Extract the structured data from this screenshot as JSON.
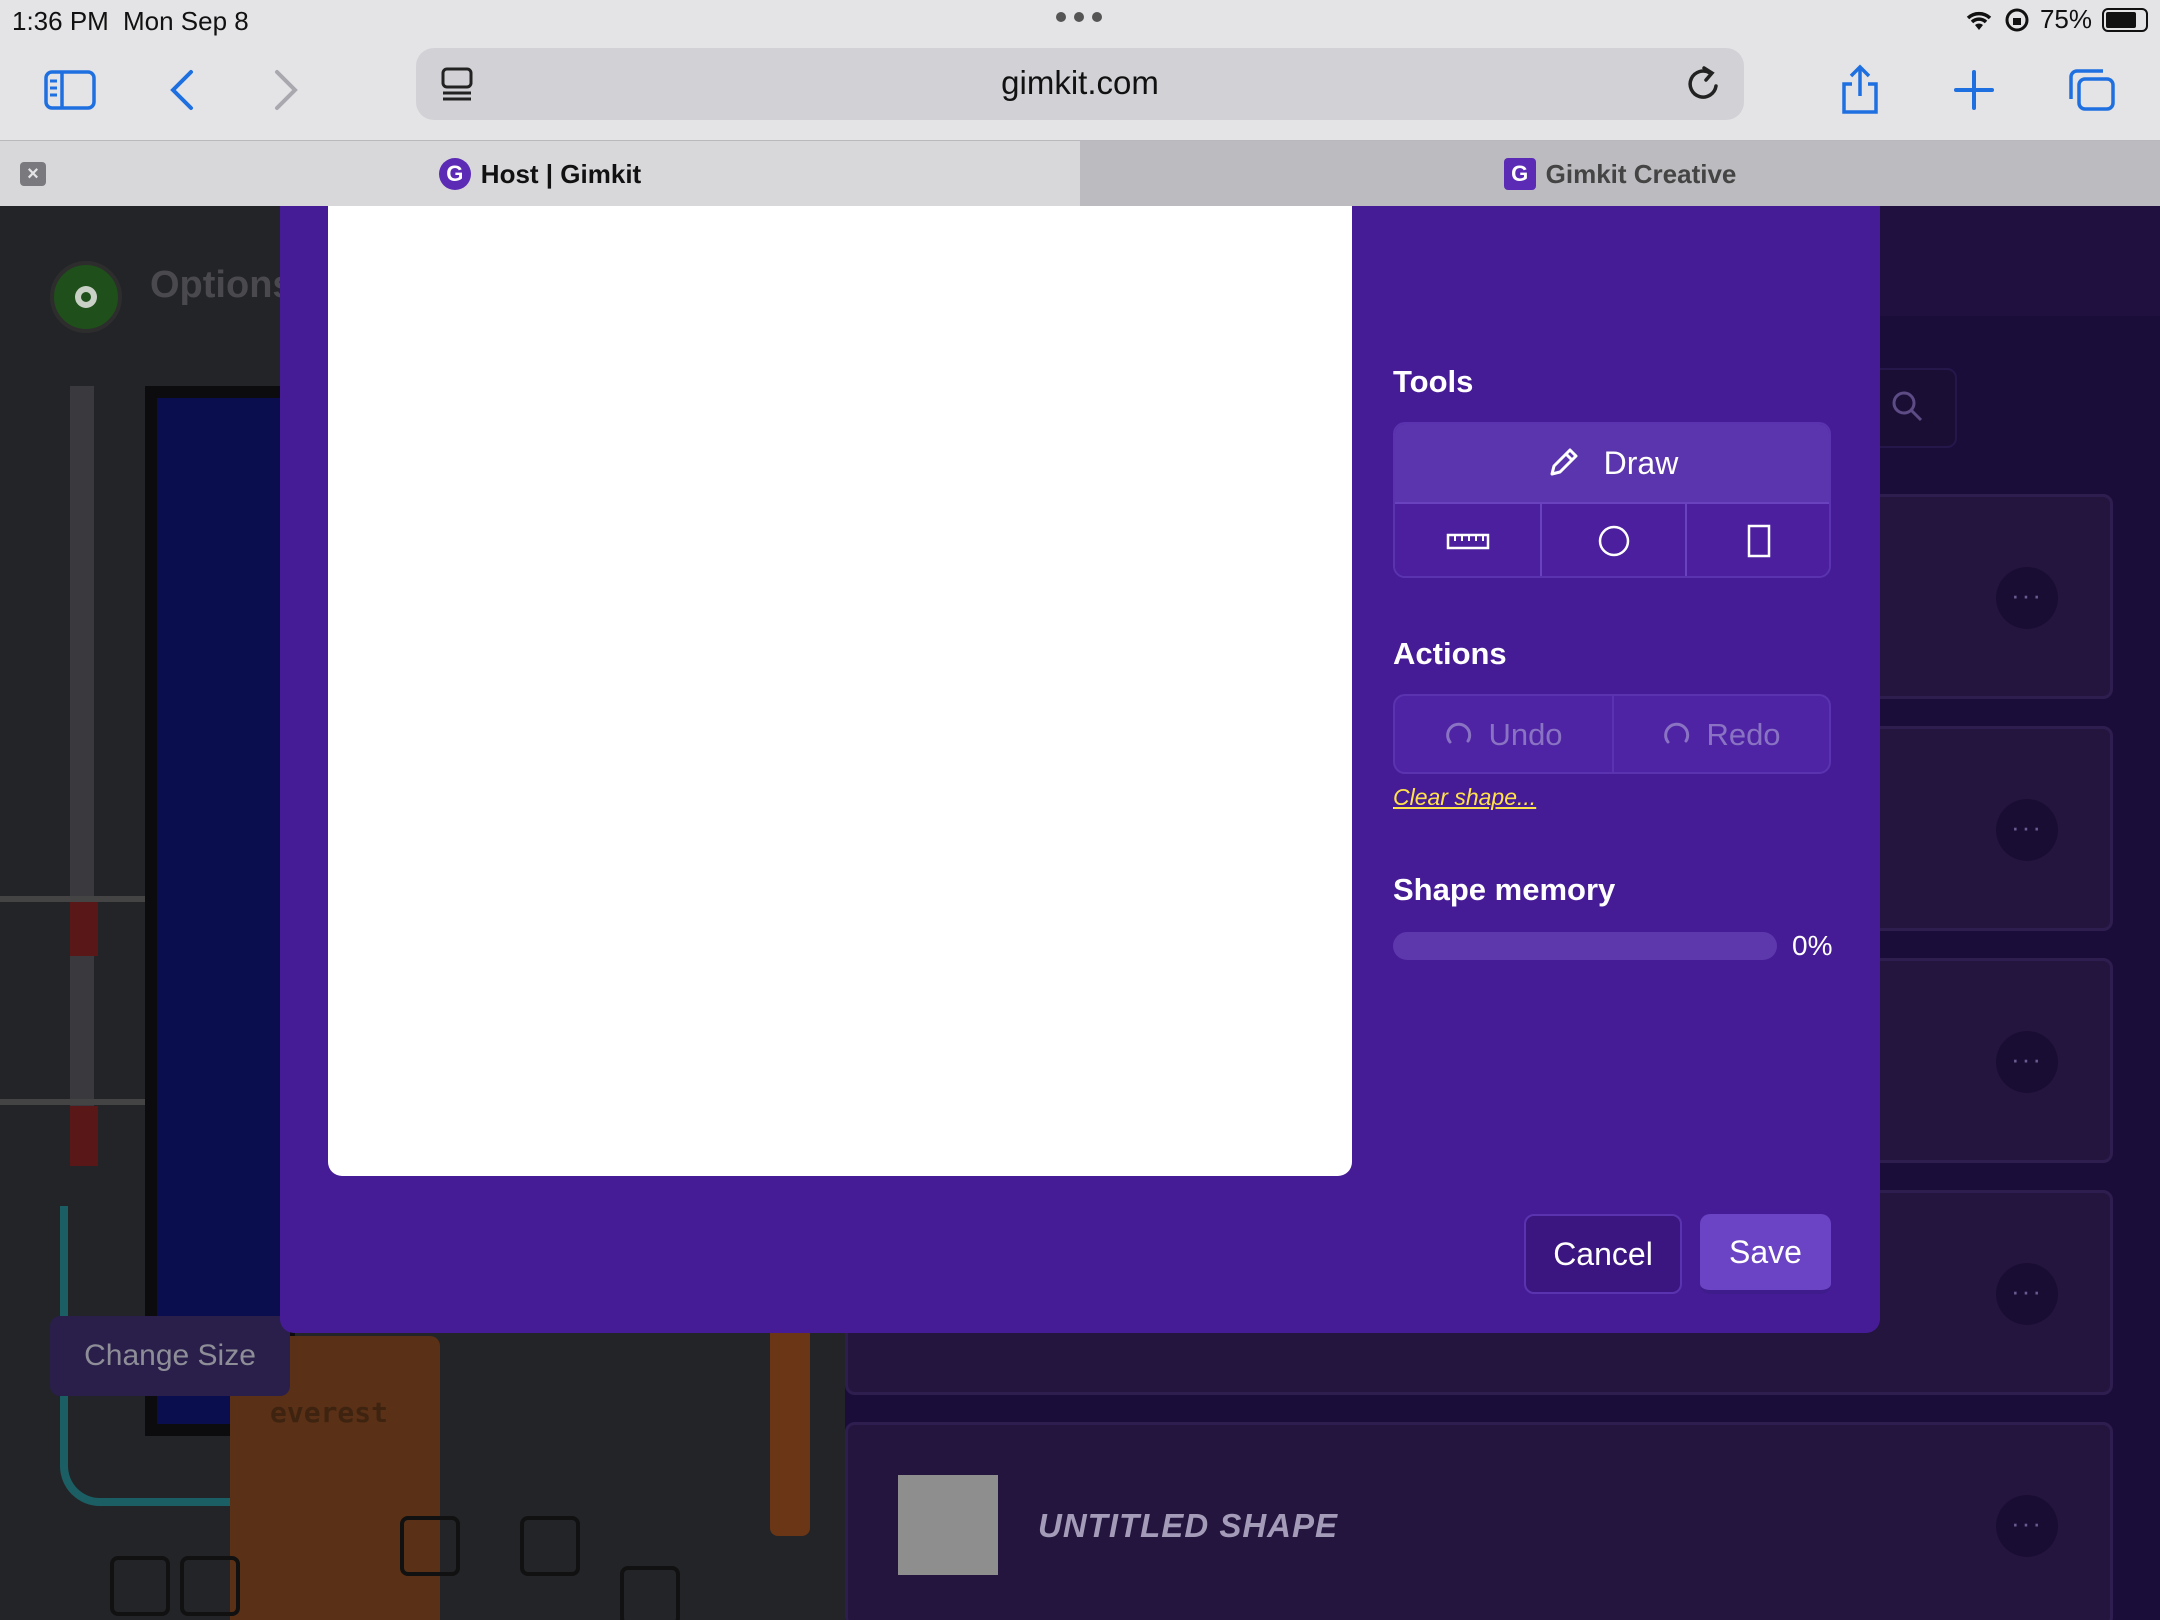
{
  "status_bar": {
    "time": "1:36 PM",
    "date": "Mon Sep 8",
    "battery": "75%"
  },
  "browser": {
    "url": "gimkit.com",
    "tabs": [
      {
        "label": "Host | Gimkit",
        "icon": "gimkit-logo-icon"
      },
      {
        "label": "Gimkit Creative",
        "icon": "gimkit-logo-icon"
      }
    ]
  },
  "background": {
    "options_label": "Options",
    "change_size_label": "Change Size",
    "map_label": "everest",
    "shape_list": [
      {
        "name": ""
      },
      {
        "name": ""
      },
      {
        "name": ""
      },
      {
        "name": ""
      },
      {
        "name": "UNTITLED SHAPE"
      }
    ],
    "menu_glyph": "···"
  },
  "modal": {
    "tools_title": "Tools",
    "draw_label": "Draw",
    "tool_icons": [
      "ruler-icon",
      "circle-icon",
      "rectangle-icon"
    ],
    "actions_title": "Actions",
    "undo_label": "Undo",
    "redo_label": "Redo",
    "clear_shape_label": "Clear shape...",
    "shape_memory_title": "Shape memory",
    "shape_memory_value": 0,
    "shape_memory_pct_label": "0%",
    "cancel_label": "Cancel",
    "save_label": "Save"
  },
  "colors": {
    "modal_bg": "#461c96",
    "accent": "#6a44c4",
    "link": "#ffe14a"
  }
}
